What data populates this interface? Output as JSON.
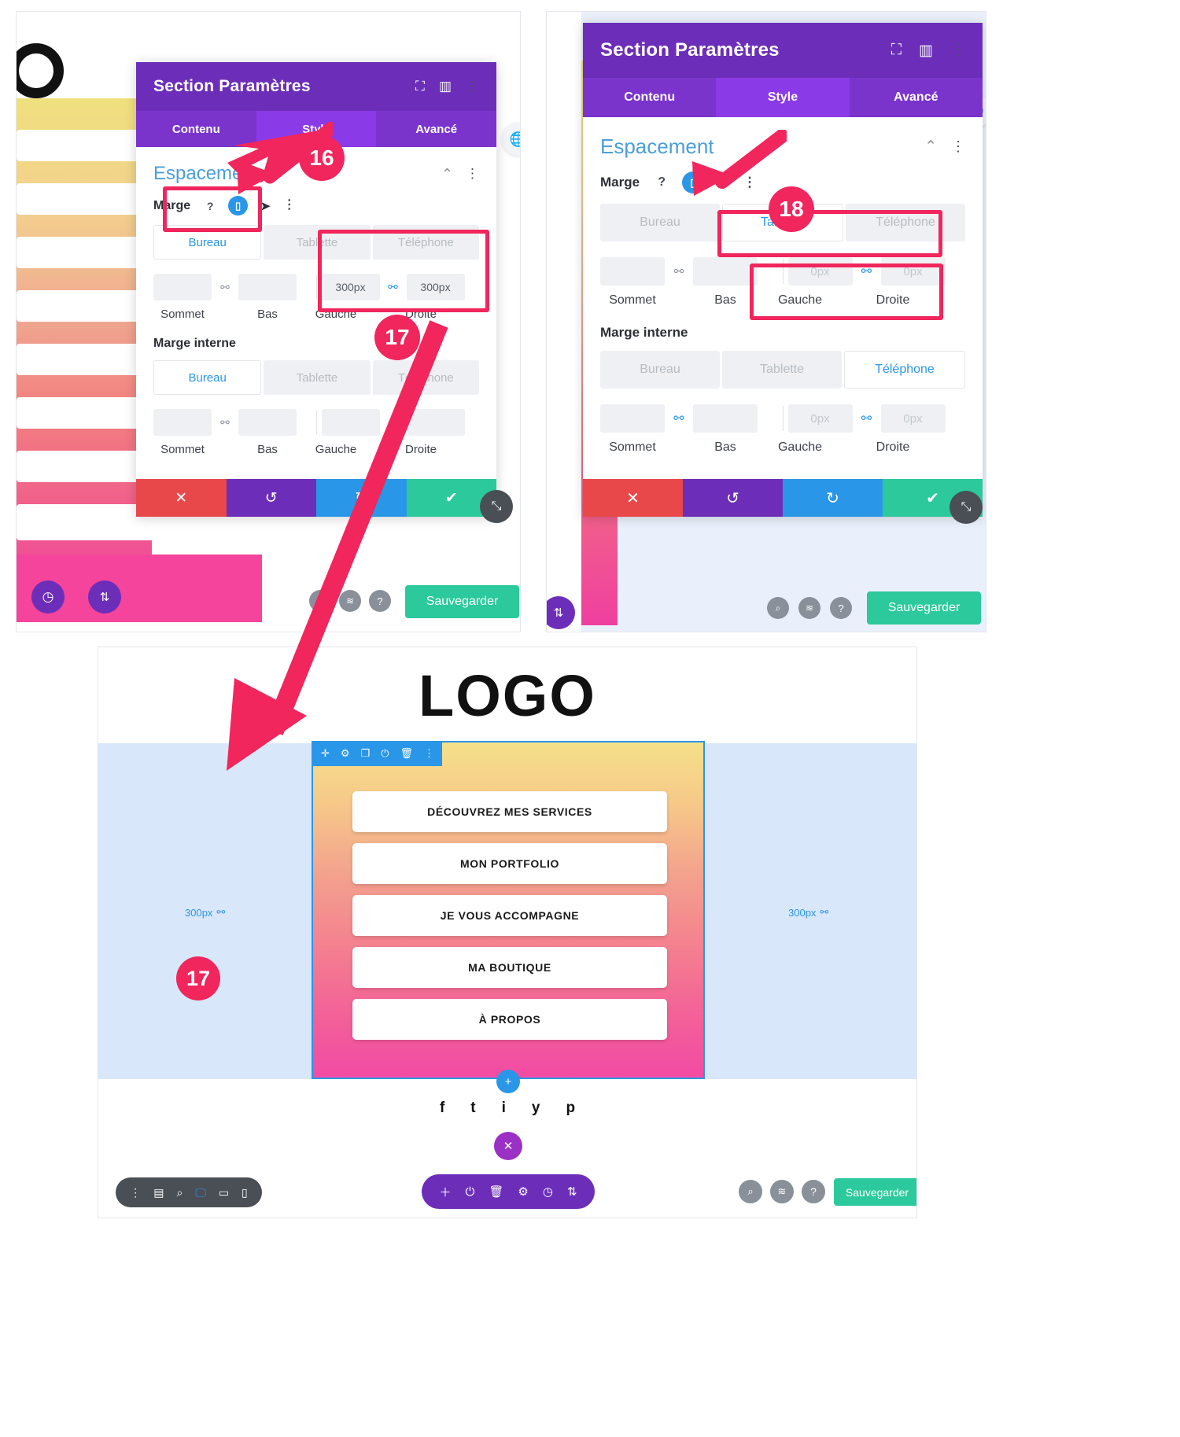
{
  "modal": {
    "title": "Section Paramètres",
    "tabs": [
      {
        "label": "Contenu",
        "active": false
      },
      {
        "label": "Style",
        "active": true
      },
      {
        "label": "Avancé",
        "active": false
      }
    ],
    "head_icons": [
      "fullscreen-icon",
      "split-view-icon",
      "kebab-menu-icon"
    ],
    "section_title": "Espacement",
    "margin_label": "Marge",
    "padding_label": "Marge interne",
    "help_icon": "?",
    "device_icon": "phone-icon",
    "cursor_icon": "pointer-icon",
    "options_icon": "kebab-menu-icon",
    "breakpoints": [
      "Bureau",
      "Tablette",
      "Téléphone"
    ],
    "captions": [
      "Sommet",
      "Bas",
      "Gauche",
      "Droite"
    ],
    "actions": [
      "cancel-x",
      "undo-arrow",
      "redo-arrow",
      "confirm-check"
    ]
  },
  "panel_left": {
    "margin": {
      "active_breakpoint": "Bureau",
      "values": {
        "sommet": "",
        "bas": "",
        "gauche": "300px",
        "droite": "300px"
      }
    },
    "padding": {
      "active_breakpoint": "Bureau",
      "values": {
        "sommet": "",
        "bas": "",
        "gauche": "",
        "droite": ""
      }
    },
    "badges": [
      {
        "number": "16"
      },
      {
        "number": "17"
      }
    ]
  },
  "panel_right": {
    "margin": {
      "active_breakpoint": "Tablette",
      "values": {
        "sommet": "",
        "bas": "",
        "gauche": "0px",
        "droite": "0px"
      }
    },
    "padding": {
      "active_breakpoint": "Téléphone",
      "values": {
        "sommet": "",
        "bas": "",
        "gauche": "0px",
        "droite": "0px"
      }
    },
    "badges": [
      {
        "number": "18"
      }
    ]
  },
  "preview": {
    "logo": "LOGO",
    "menu_items": [
      "DÉCOUVREZ MES SERVICES",
      "MON PORTFOLIO",
      "JE VOUS ACCOMPAGNE",
      "MA BOUTIQUE",
      "À PROPOS"
    ],
    "margin_left_label": "300px",
    "margin_right_label": "300px",
    "margin_link_icon": "link-icon",
    "badge": "17",
    "social": [
      {
        "name": "facebook-icon",
        "glyph": "f"
      },
      {
        "name": "twitter-icon",
        "glyph": "t"
      },
      {
        "name": "instagram-icon",
        "glyph": "i"
      },
      {
        "name": "youtube-icon",
        "glyph": "y"
      },
      {
        "name": "pinterest-icon",
        "glyph": "p"
      }
    ],
    "toolbar_icons": [
      "move-icon",
      "gear-icon",
      "duplicate-icon",
      "power-icon",
      "trash-icon",
      "kebab-menu-icon"
    ],
    "left_toolbar_icons": [
      "kebab-menu-icon",
      "wireframe-icon",
      "zoom-icon",
      "desktop-icon",
      "tablet-icon",
      "phone-icon"
    ],
    "center_toolbar_icons": [
      "plus-icon",
      "power-icon",
      "trash-icon",
      "gear-icon",
      "history-icon",
      "updown-icon"
    ],
    "right_toolbar_icons": [
      "zoom-icon",
      "layers-icon",
      "help-icon"
    ],
    "save_label": "Sauvegarder",
    "close_icon": "close-icon",
    "add_icon": "plus-icon"
  },
  "panel_side_icons": {
    "globe_icon": "globe-icon",
    "clock_icon": "clock-icon",
    "updown_icon": "updown-icon",
    "zoom_icon": "zoom-icon",
    "layers_icon": "layers-icon",
    "help_icon": "help-icon",
    "save_label": "Sauvegarder"
  },
  "colors": {
    "purple": "#6c2eb9",
    "purple_light": "#8b3ae8",
    "pink": "#f0265c",
    "blue": "#2a96e8",
    "green": "#2bc99b",
    "red": "#e8484a"
  }
}
